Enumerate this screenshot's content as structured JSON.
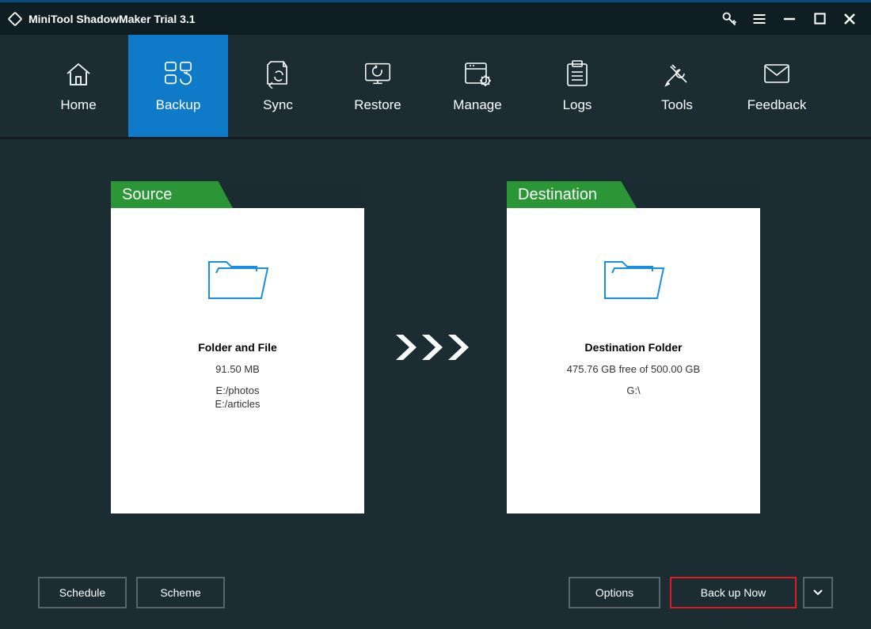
{
  "window": {
    "title": "MiniTool ShadowMaker Trial 3.1"
  },
  "nav": {
    "items": [
      {
        "label": "Home"
      },
      {
        "label": "Backup",
        "active": true
      },
      {
        "label": "Sync"
      },
      {
        "label": "Restore"
      },
      {
        "label": "Manage"
      },
      {
        "label": "Logs"
      },
      {
        "label": "Tools"
      },
      {
        "label": "Feedback"
      }
    ]
  },
  "source": {
    "header": "Source",
    "title": "Folder and File",
    "size": "91.50 MB",
    "paths": [
      "E:/photos",
      "E:/articles"
    ]
  },
  "destination": {
    "header": "Destination",
    "title": "Destination Folder",
    "free": "475.76 GB free of 500.00 GB",
    "path": "G:\\"
  },
  "buttons": {
    "schedule": "Schedule",
    "scheme": "Scheme",
    "options": "Options",
    "backup_now": "Back up Now"
  }
}
